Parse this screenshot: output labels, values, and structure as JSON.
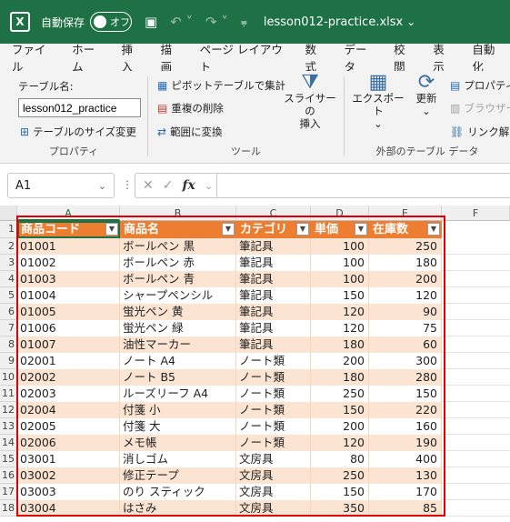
{
  "title_bar": {
    "autosave_label": "自動保存",
    "toggle_label": "オフ",
    "filename": "lesson012-practice.xlsx",
    "logo_letter": "X"
  },
  "menu": [
    "ファイル",
    "ホーム",
    "挿入",
    "描画",
    "ページ レイアウト",
    "数式",
    "データ",
    "校閲",
    "表示",
    "自動化"
  ],
  "ribbon": {
    "properties": {
      "table_name_label": "テーブル名:",
      "table_name_value": "lesson012_practice",
      "resize_label": "テーブルのサイズ変更",
      "group_label": "プロパティ"
    },
    "tools": {
      "pivot_label": "ピボットテーブルで集計",
      "dedupe_label": "重複の削除",
      "convert_label": "範囲に変換",
      "slicer_label_1": "スライサーの",
      "slicer_label_2": "挿入",
      "group_label": "ツール"
    },
    "external": {
      "export_label": "エクスポート",
      "refresh_label": "更新",
      "properties_label": "プロパティ",
      "browser_label": "ブラウザー",
      "unlink_label": "リンク解除",
      "group_label": "外部のテーブル データ"
    }
  },
  "formula_bar": {
    "name_box": "A1",
    "fx": "fx",
    "cancel": "✕",
    "enter": "✓"
  },
  "columns": [
    "A",
    "B",
    "C",
    "D",
    "E",
    "F"
  ],
  "table": {
    "headers": [
      "商品コード",
      "商品名",
      "カテゴリ",
      "単価",
      "在庫数"
    ],
    "rows": [
      [
        "01001",
        "ボールペン 黒",
        "筆記具",
        "100",
        "250"
      ],
      [
        "01002",
        "ボールペン 赤",
        "筆記具",
        "100",
        "180"
      ],
      [
        "01003",
        "ボールペン 青",
        "筆記具",
        "100",
        "200"
      ],
      [
        "01004",
        "シャープペンシル",
        "筆記具",
        "150",
        "120"
      ],
      [
        "01005",
        "蛍光ペン 黄",
        "筆記具",
        "120",
        "90"
      ],
      [
        "01006",
        "蛍光ペン 緑",
        "筆記具",
        "120",
        "75"
      ],
      [
        "01007",
        "油性マーカー",
        "筆記具",
        "180",
        "60"
      ],
      [
        "02001",
        "ノート A4",
        "ノート類",
        "200",
        "300"
      ],
      [
        "02002",
        "ノート B5",
        "ノート類",
        "180",
        "280"
      ],
      [
        "02003",
        "ルーズリーフ A4",
        "ノート類",
        "250",
        "150"
      ],
      [
        "02004",
        "付箋 小",
        "ノート類",
        "150",
        "220"
      ],
      [
        "02005",
        "付箋 大",
        "ノート類",
        "200",
        "160"
      ],
      [
        "02006",
        "メモ帳",
        "ノート類",
        "120",
        "190"
      ],
      [
        "03001",
        "消しゴム",
        "文房具",
        "80",
        "400"
      ],
      [
        "03002",
        "修正テープ",
        "文房具",
        "250",
        "130"
      ],
      [
        "03003",
        "のり スティック",
        "文房具",
        "150",
        "170"
      ],
      [
        "03004",
        "はさみ",
        "文房具",
        "350",
        "85"
      ]
    ]
  },
  "row_numbers": [
    "1",
    "2",
    "3",
    "4",
    "5",
    "6",
    "7",
    "8",
    "9",
    "10",
    "11",
    "12",
    "13",
    "14",
    "15",
    "16",
    "17",
    "18"
  ]
}
